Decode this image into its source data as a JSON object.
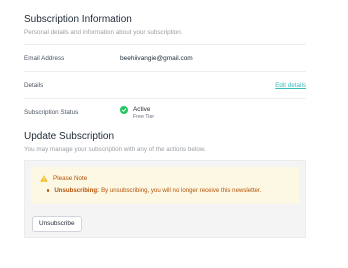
{
  "subscription_info": {
    "title": "Subscription Information",
    "subtitle": "Personal details and information about your subscription."
  },
  "rows": {
    "email": {
      "label": "Email Address",
      "value": "beehiivangie@gmail.com"
    },
    "details": {
      "label": "Details",
      "link": "Edit details"
    },
    "status": {
      "label": "Subscription Status",
      "value": "Active",
      "tier": "Free Tier"
    }
  },
  "update": {
    "title": "Update Subscription",
    "subtitle": "You may manage your subscription with any of the actions below."
  },
  "note": {
    "title": "Please Note",
    "item_bold": "Unsubscribing:",
    "item_text": "By unsubscribing, you will no longer receive this newsletter."
  },
  "actions": {
    "unsubscribe_label": "Unsubscribe"
  },
  "icons": {
    "status": "check-circle-icon",
    "note": "warning-triangle-icon"
  },
  "colors": {
    "link": "#38bdba",
    "active": "#22c55e",
    "note_bg": "#fdf8e3",
    "note_text": "#b45309"
  }
}
